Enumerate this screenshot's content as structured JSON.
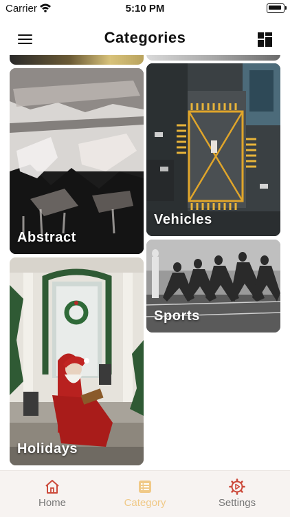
{
  "status_bar": {
    "carrier": "Carrier",
    "time": "5:10 PM"
  },
  "header": {
    "title": "Categories",
    "menu_icon": "hamburger-menu-icon",
    "layout_icon": "grid-layout-icon"
  },
  "categories": [
    {
      "label": "Abstract"
    },
    {
      "label": "Vehicles"
    },
    {
      "label": "Sports"
    },
    {
      "label": "Holidays"
    }
  ],
  "tab_bar": {
    "tabs": [
      {
        "label": "Home",
        "icon": "home-icon",
        "active": false
      },
      {
        "label": "Category",
        "icon": "list-icon",
        "active": true
      },
      {
        "label": "Settings",
        "icon": "gear-icon",
        "active": false
      }
    ],
    "inactive_color": "#cc4a3b",
    "active_color": "#f0c987"
  }
}
